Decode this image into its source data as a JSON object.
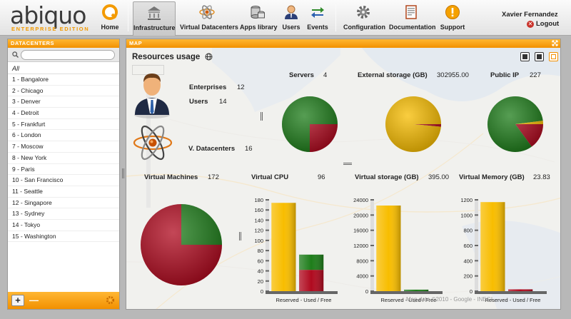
{
  "app": {
    "logo_word": "abiquo",
    "logo_tagline": "ENTERPRISE EDITION"
  },
  "nav": {
    "home": "Home",
    "infrastructure": "Infrastructure",
    "virtual_datacenters": "Virtual Datacenters",
    "apps_library": "Apps library",
    "users": "Users",
    "events": "Events",
    "configuration": "Configuration",
    "documentation": "Documentation",
    "support": "Support",
    "active": "infrastructure"
  },
  "user": {
    "name": "Xavier Fernandez",
    "logout_label": "Logout"
  },
  "left_panel": {
    "title": "DATACENTERS",
    "search_placeholder": "",
    "all_label": "All",
    "datacenters": [
      "1 - Bangalore",
      "2 - Chicago",
      "3 - Denver",
      "4 - Detroit",
      "5 - Frankfurt",
      "6 - London",
      "7 - Moscow",
      "8 - New York",
      "9 - Paris",
      "10 - San Francisco",
      "11 - Seattle",
      "12 - Singapore",
      "13 - Sydney",
      "14 - Tokyo",
      "15 - Washington"
    ]
  },
  "map_panel": {
    "title": "MAP",
    "resources_title": "Resources usage",
    "enterprises_label": "Enterprises",
    "enterprises_value": "12",
    "users_label": "Users",
    "users_value": "14",
    "vdc_label": "V. Datacenters",
    "vdc_value": "16",
    "servers_label": "Servers",
    "servers_value": "4",
    "ext_storage_label": "External storage (GB)",
    "ext_storage_value": "302955.00",
    "public_ip_label": "Public IP",
    "public_ip_value": "227",
    "vm_label": "Virtual Machines",
    "vm_value": "172",
    "vcpu_label": "Virtual CPU",
    "vcpu_value": "96",
    "vstorage_label": "Virtual storage (GB)",
    "vstorage_value": "395.00",
    "vmemory_label": "Virtual Memory (GB)",
    "vmemory_value": "23.83",
    "bar_caption": "Reserved - Used / Free",
    "map_footer": "Map data ©2010 - Google - INEGI"
  },
  "colors": {
    "accent_orange": "#f29000",
    "used_red": "#b00a1f",
    "free_green": "#1e7d1a",
    "reserved_yellow": "#f8bd00"
  },
  "chart_data": [
    {
      "type": "pie",
      "title": "Servers",
      "slices": [
        {
          "label": "Free",
          "value": 0.75,
          "color": "#1e7d1a"
        },
        {
          "label": "Used",
          "value": 0.25,
          "color": "#b00a1f"
        }
      ]
    },
    {
      "type": "pie",
      "title": "External storage (GB)",
      "slices": [
        {
          "label": "Reserved",
          "value": 0.985,
          "color": "#f8bd00"
        },
        {
          "label": "Used",
          "value": 0.015,
          "color": "#b00a1f"
        }
      ]
    },
    {
      "type": "pie",
      "title": "Public IP",
      "slices": [
        {
          "label": "Free",
          "value": 0.83,
          "color": "#1e7d1a"
        },
        {
          "label": "Used",
          "value": 0.15,
          "color": "#b00a1f"
        },
        {
          "label": "Reserved",
          "value": 0.02,
          "color": "#f8bd00"
        }
      ]
    },
    {
      "type": "pie",
      "title": "Virtual Machines",
      "slices": [
        {
          "label": "Free",
          "value": 0.25,
          "color": "#1e7d1a"
        },
        {
          "label": "Used",
          "value": 0.75,
          "color": "#b00a1f"
        }
      ]
    },
    {
      "type": "bar",
      "title": "Virtual CPU",
      "xlabel": "Reserved - Used / Free",
      "ylim": [
        0,
        180
      ],
      "yticks": [
        0,
        20,
        40,
        60,
        80,
        100,
        120,
        140,
        160,
        180
      ],
      "bars": [
        {
          "segments": [
            {
              "label": "Reserved",
              "value": 174,
              "color": "#f8bd00"
            }
          ]
        },
        {
          "segments": [
            {
              "label": "Used",
              "value": 42,
              "color": "#b00a1f"
            },
            {
              "label": "Free",
              "value": 30,
              "color": "#1e7d1a"
            }
          ]
        }
      ]
    },
    {
      "type": "bar",
      "title": "Virtual storage (GB)",
      "xlabel": "Reserved - Used / Free",
      "ylim": [
        0,
        24000
      ],
      "yticks": [
        0,
        4000,
        8000,
        12000,
        16000,
        20000,
        24000
      ],
      "bars": [
        {
          "segments": [
            {
              "label": "Reserved",
              "value": 22500,
              "color": "#f8bd00"
            }
          ]
        },
        {
          "segments": [
            {
              "label": "Used",
              "value": 0,
              "color": "#b00a1f"
            },
            {
              "label": "Free",
              "value": 395,
              "color": "#1e7d1a"
            }
          ]
        }
      ]
    },
    {
      "type": "bar",
      "title": "Virtual Memory (GB)",
      "xlabel": "Reserved - Used / Free",
      "ylim": [
        0,
        1200
      ],
      "yticks": [
        0,
        200,
        400,
        600,
        800,
        1000,
        1200
      ],
      "bars": [
        {
          "segments": [
            {
              "label": "Reserved",
              "value": 1170,
              "color": "#f8bd00"
            }
          ]
        },
        {
          "segments": [
            {
              "label": "Used",
              "value": 24,
              "color": "#b00a1f"
            },
            {
              "label": "Free",
              "value": 0,
              "color": "#1e7d1a"
            }
          ]
        }
      ]
    }
  ]
}
